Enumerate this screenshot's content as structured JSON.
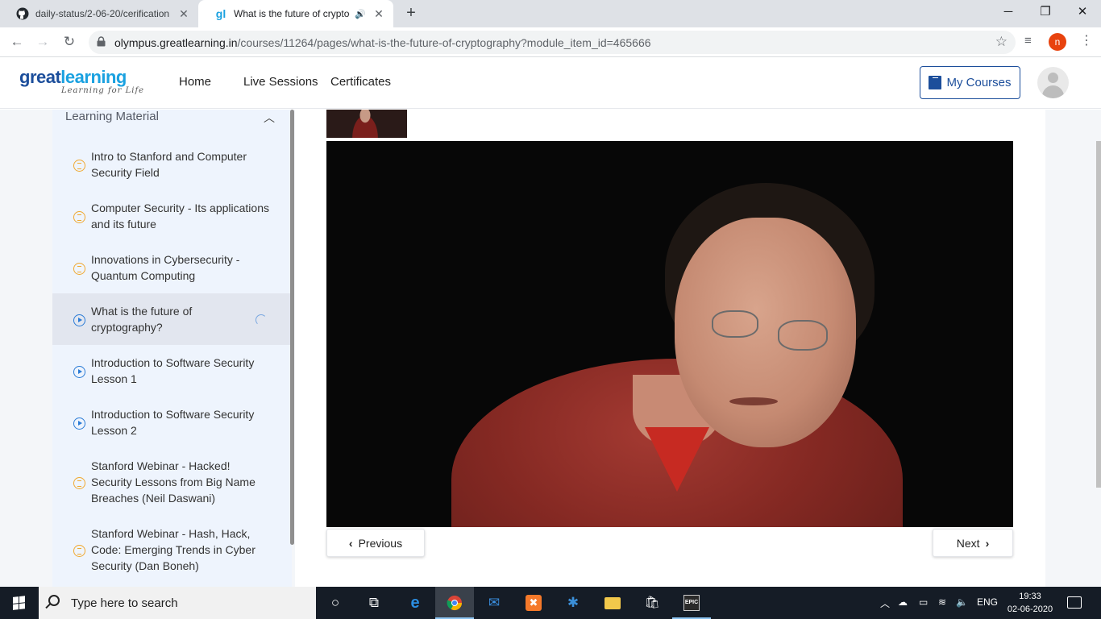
{
  "browser": {
    "tabs": [
      {
        "title": "daily-status/2-06-20/cerification",
        "close": "✕"
      },
      {
        "title": "What is the future of cryptog",
        "close": "✕"
      }
    ],
    "new_tab": "+",
    "url_host": "olympus.greatlearning.in",
    "url_path": "/courses/11264/pages/what-is-the-future-of-cryptography?module_item_id=465666",
    "profile_initial": "n",
    "window_controls": {
      "minimize": "─",
      "restore": "❐",
      "close": "✕"
    }
  },
  "header": {
    "logo_main_a": "great",
    "logo_main_b": "learning",
    "logo_sub": "Learning for Life",
    "nav": [
      "Home",
      "Live Sessions",
      "Certificates"
    ],
    "my_courses": "My Courses"
  },
  "sidebar": {
    "section_title": "Learning Material",
    "items": [
      {
        "label": "Intro to Stanford and Computer Security Field",
        "icon": "document-icon"
      },
      {
        "label": "Computer Security - Its applications and its future",
        "icon": "document-icon"
      },
      {
        "label": "Innovations in Cybersecurity - Quantum Computing",
        "icon": "document-icon"
      },
      {
        "label": "What is the future of cryptography?",
        "icon": "play-icon",
        "active": true
      },
      {
        "label": "Introduction to Software Security Lesson 1",
        "icon": "play-icon"
      },
      {
        "label": "Introduction to Software Security Lesson 2",
        "icon": "play-icon"
      },
      {
        "label": "Stanford Webinar - Hacked! Security Lessons from Big Name Breaches (Neil Daswani)",
        "icon": "document-icon"
      },
      {
        "label": "Stanford Webinar - Hash, Hack, Code: Emerging Trends in Cyber Security (Dan Boneh)",
        "icon": "document-icon"
      }
    ]
  },
  "content": {
    "prev_label": "Previous",
    "next_label": "Next"
  },
  "taskbar": {
    "search_placeholder": "Type here to search",
    "language": "ENG",
    "time": "19:33",
    "date": "02-06-2020"
  },
  "colors": {
    "brand_dark": "#1c4e9b",
    "brand_light": "#1aa1e0",
    "doc_icon": "#f0a830",
    "play_icon": "#2a7bd6"
  }
}
